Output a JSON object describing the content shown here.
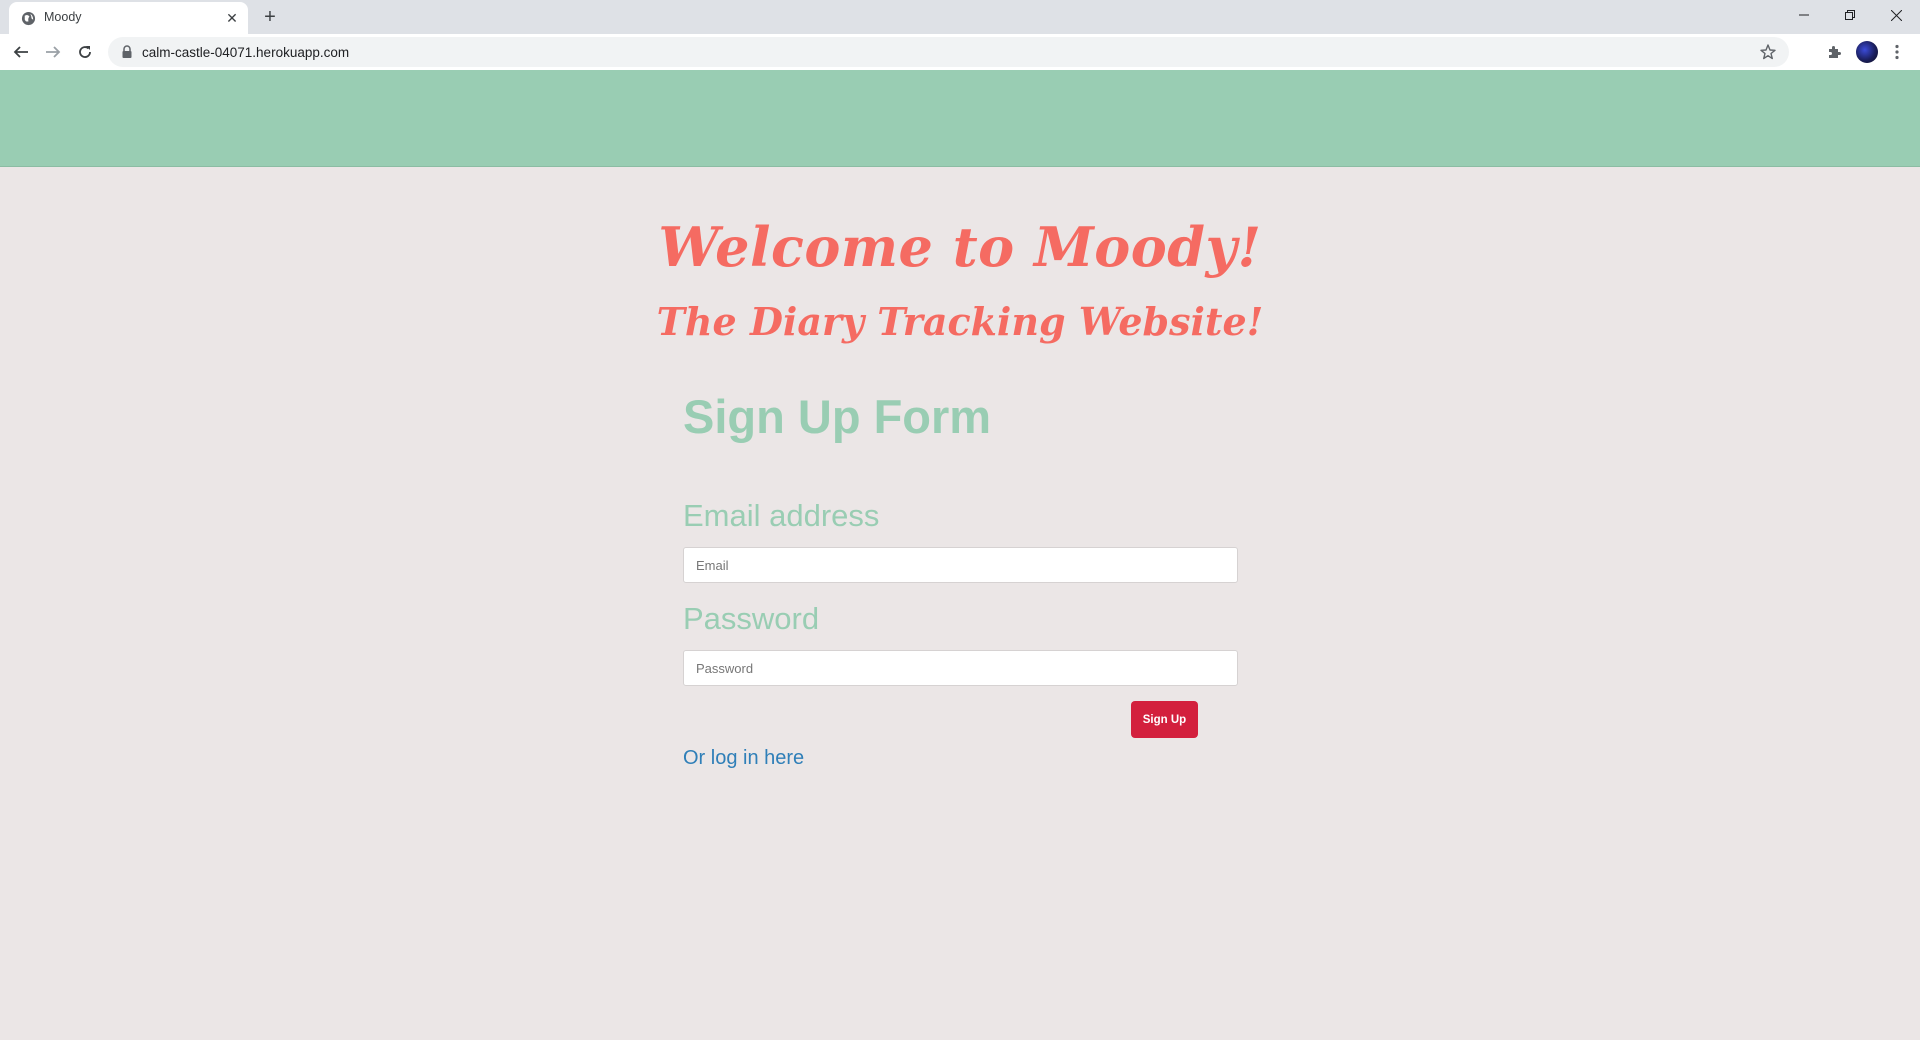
{
  "browser": {
    "tab_title": "Moody",
    "url": "calm-castle-04071.herokuapp.com"
  },
  "page": {
    "welcome_title": "Welcome to Moody!",
    "welcome_subtitle": "The Diary Tracking Website!",
    "form_title": "Sign Up Form",
    "email_label": "Email address",
    "email_placeholder": "Email",
    "password_label": "Password",
    "password_placeholder": "Password",
    "signup_button": "Sign Up",
    "login_link": "Or log in here"
  },
  "colors": {
    "header_bg": "#99cdb3",
    "page_bg": "#ebe6e6",
    "accent_red": "#f56b62",
    "button_red": "#d3203d",
    "link_blue": "#2f7fb8"
  }
}
